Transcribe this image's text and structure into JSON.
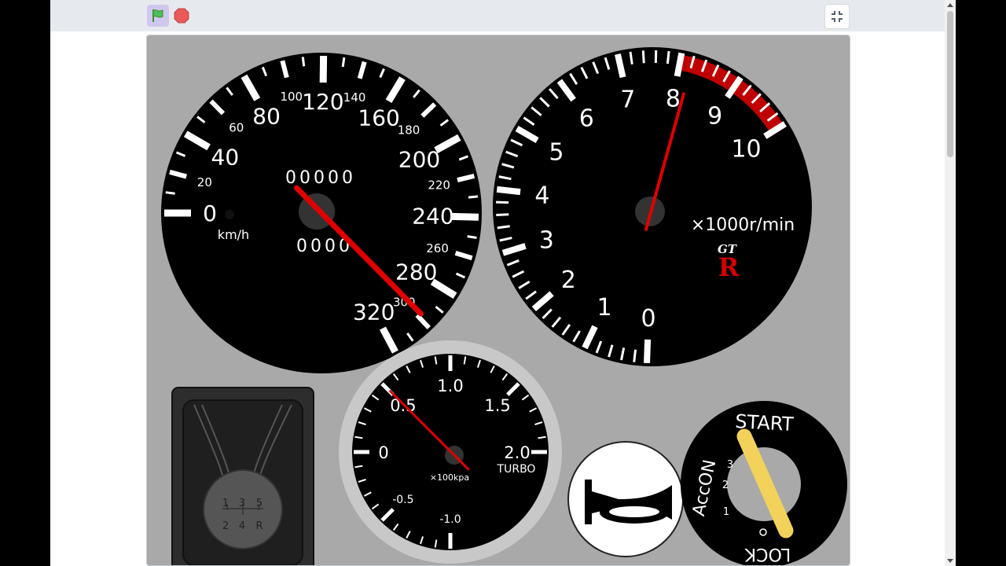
{
  "toolbar": {
    "green_flag_icon": "green-flag-icon",
    "stop_icon": "stop-icon",
    "fullscreen_icon": "exit-fullscreen-icon"
  },
  "speedometer": {
    "major_labels": [
      "0",
      "40",
      "80",
      "120",
      "160",
      "200",
      "240",
      "280",
      "320"
    ],
    "minor_labels": [
      "20",
      "60",
      "100",
      "140",
      "180",
      "220",
      "260",
      "300"
    ],
    "unit": "km/h",
    "odometer": "00000",
    "trip": "0000",
    "needle_speed_kmh": 298
  },
  "tachometer": {
    "labels": [
      "0",
      "1",
      "2",
      "3",
      "4",
      "5",
      "6",
      "7",
      "8",
      "9",
      "10"
    ],
    "unit": "×1000r/min",
    "logo_top": "GT",
    "logo_bottom": "R",
    "redline_from": 8,
    "needle_rpm_x1000": 8.2
  },
  "boost_gauge": {
    "labels": [
      "-1.0",
      "-0.5",
      "0",
      "0.5",
      "1.0",
      "1.5",
      "2.0"
    ],
    "unit": "×100kpa",
    "name": "TURBO",
    "needle_value": 0.5
  },
  "shifter": {
    "top_row": [
      "1",
      "3",
      "5"
    ],
    "bottom_row": [
      "2",
      "4",
      "R"
    ]
  },
  "horn": {
    "icon": "horn-icon"
  },
  "ignition": {
    "start": "START",
    "acc_on": "AccON",
    "lock": "LOCK",
    "positions": [
      "1",
      "2",
      "3"
    ]
  },
  "colors": {
    "stage_bg": "#a9a9a9",
    "gauge_face": "#000000",
    "needle": "#e00000",
    "redline": "#c00000",
    "key": "#f2d25a"
  }
}
